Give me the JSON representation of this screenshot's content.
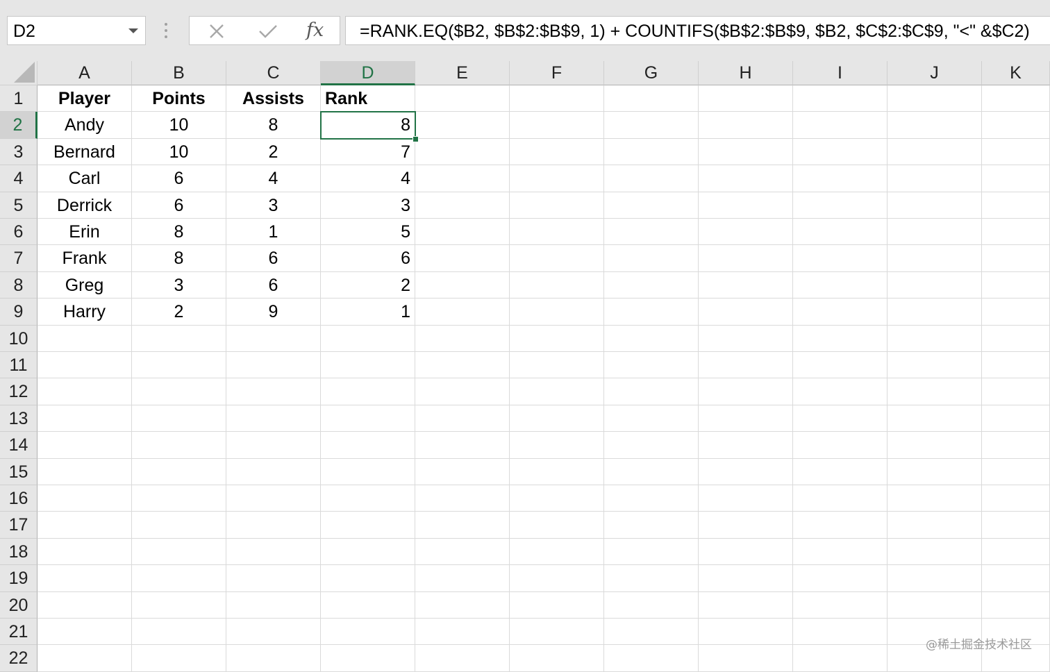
{
  "formula_bar": {
    "name_box": "D2",
    "fx_label": "fx",
    "formula": "=RANK.EQ($B2, $B$2:$B$9, 1) + COUNTIFS($B$2:$B$9, $B2, $C$2:$C$9, \"<\" &$C2)"
  },
  "sheet": {
    "columns": [
      "A",
      "B",
      "C",
      "D",
      "E",
      "F",
      "G",
      "H",
      "I",
      "J",
      "K"
    ],
    "selected_column": "D",
    "rows": [
      "1",
      "2",
      "3",
      "4",
      "5",
      "6",
      "7",
      "8",
      "9",
      "10",
      "11",
      "12",
      "13",
      "14",
      "15",
      "16",
      "17",
      "18",
      "19",
      "20",
      "21",
      "22"
    ],
    "selected_row": "2",
    "headers": {
      "player": "Player",
      "points": "Points",
      "assists": "Assists",
      "rank": "Rank"
    },
    "data": [
      {
        "player": "Andy",
        "points": "10",
        "assists": "8",
        "rank": "8"
      },
      {
        "player": "Bernard",
        "points": "10",
        "assists": "2",
        "rank": "7"
      },
      {
        "player": "Carl",
        "points": "6",
        "assists": "4",
        "rank": "4"
      },
      {
        "player": "Derrick",
        "points": "6",
        "assists": "3",
        "rank": "3"
      },
      {
        "player": "Erin",
        "points": "8",
        "assists": "1",
        "rank": "5"
      },
      {
        "player": "Frank",
        "points": "8",
        "assists": "6",
        "rank": "6"
      },
      {
        "player": "Greg",
        "points": "3",
        "assists": "6",
        "rank": "2"
      },
      {
        "player": "Harry",
        "points": "2",
        "assists": "9",
        "rank": "1"
      }
    ]
  },
  "watermark": "@稀土掘金技术社区",
  "colors": {
    "accent": "#217346",
    "header_bg": "#e6e6e6"
  }
}
